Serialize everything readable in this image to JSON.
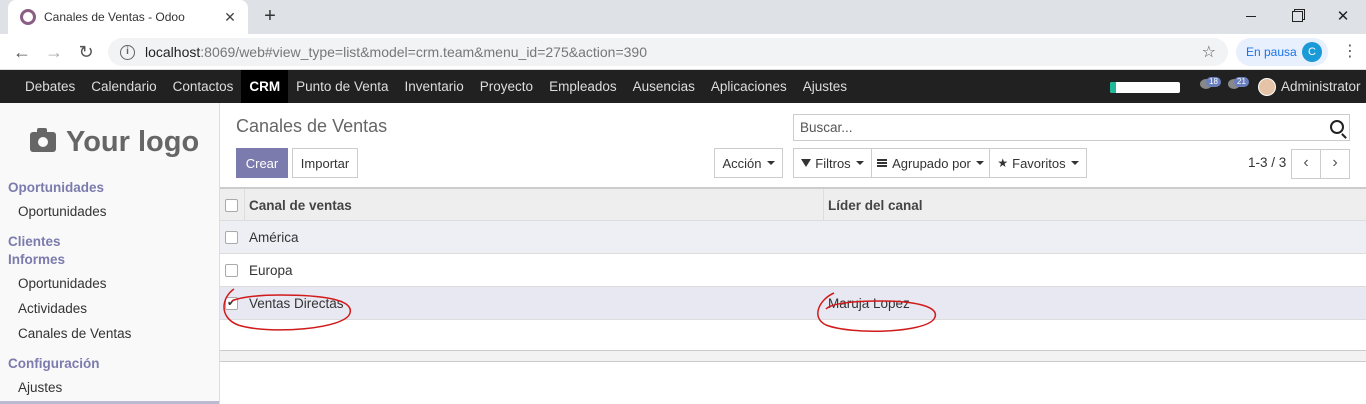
{
  "browser": {
    "tab_title": "Canales de Ventas - Odoo",
    "url_host": "localhost",
    "url_rest": ":8069/web#view_type=list&model=crm.team&menu_id=275&action=390",
    "pause_label": "En pausa",
    "profile_initial": "C"
  },
  "appbar": {
    "items": [
      "Debates",
      "Calendario",
      "Contactos",
      "CRM",
      "Punto de Venta",
      "Inventario",
      "Proyecto",
      "Empleados",
      "Ausencias",
      "Aplicaciones",
      "Ajustes"
    ],
    "active": "CRM",
    "progress_fraction": 0.08,
    "activity_count": "18",
    "message_count": "21",
    "user_name": "Administrator"
  },
  "sidebar": {
    "logo_text": "Your logo",
    "sections": {
      "oportunidades": "Oportunidades",
      "clientes": "Clientes",
      "informes": "Informes",
      "configuracion": "Configuración"
    },
    "items": {
      "oportunidades": "Oportunidades",
      "inf_oportunidades": "Oportunidades",
      "actividades": "Actividades",
      "canales": "Canales de Ventas",
      "ajustes": "Ajustes"
    }
  },
  "control_panel": {
    "title": "Canales de Ventas",
    "search_placeholder": "Buscar...",
    "create_label": "Crear",
    "import_label": "Importar",
    "action_label": "Acción",
    "filters_label": "Filtros",
    "groupby_label": "Agrupado por",
    "favorites_label": "Favoritos",
    "pager": "1-3 / 3"
  },
  "table": {
    "headers": [
      "Canal de ventas",
      "Líder del canal"
    ],
    "rows": [
      {
        "canal": "América",
        "lider": "",
        "checked": false
      },
      {
        "canal": "Europa",
        "lider": "",
        "checked": false
      },
      {
        "canal": "Ventas Directas",
        "lider": "Maruja Lopez",
        "checked": true
      }
    ]
  },
  "colors": {
    "odoo_primary": "#7c7bad",
    "appbar_bg": "#212121",
    "annotation_red": "#d11a1a"
  }
}
